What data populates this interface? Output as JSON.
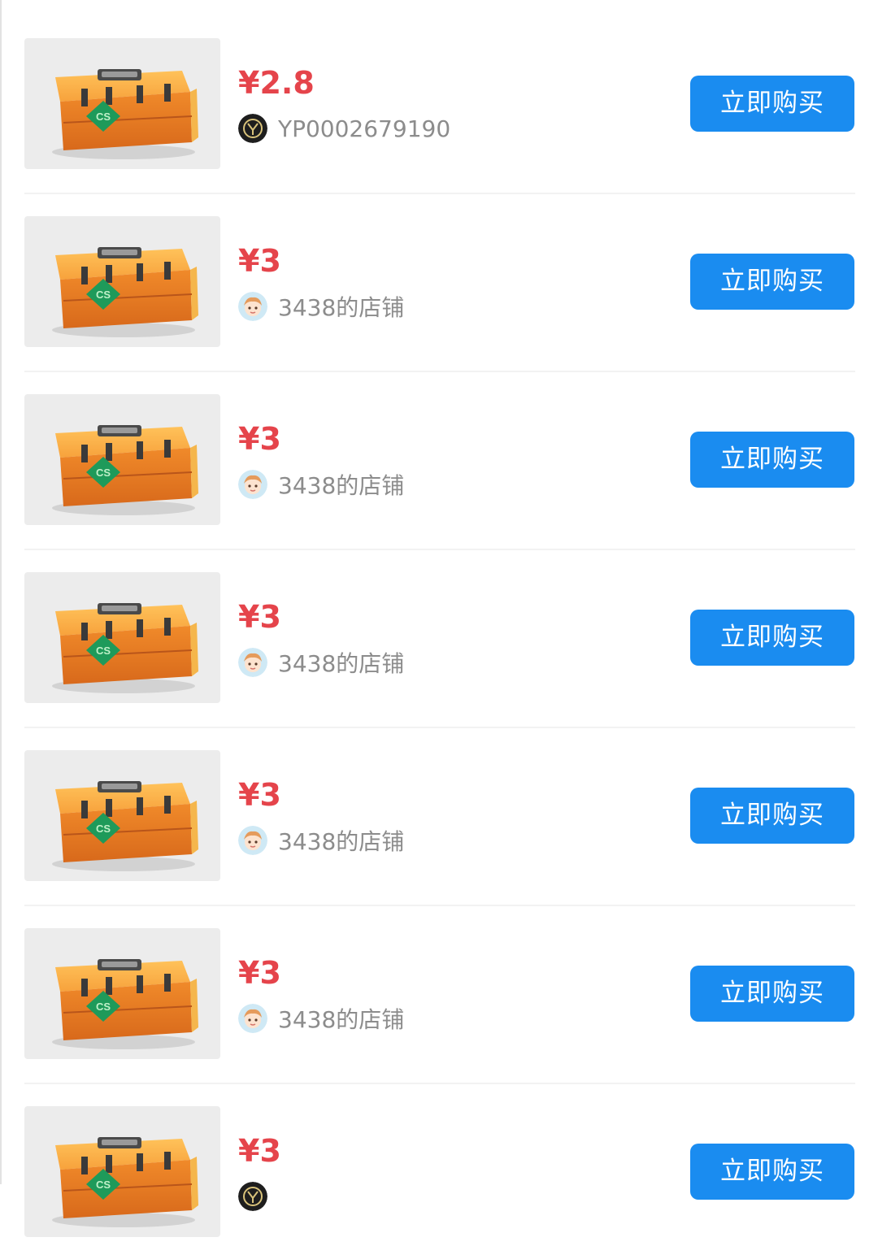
{
  "listings": [
    {
      "price": "¥2.8",
      "seller": "YP0002679190",
      "seller_avatar": "logo-avatar",
      "buy_label": "立即购买"
    },
    {
      "price": "¥3",
      "seller": "3438的店铺",
      "seller_avatar": "cartoon-avatar",
      "buy_label": "立即购买"
    },
    {
      "price": "¥3",
      "seller": "3438的店铺",
      "seller_avatar": "cartoon-avatar",
      "buy_label": "立即购买"
    },
    {
      "price": "¥3",
      "seller": "3438的店铺",
      "seller_avatar": "cartoon-avatar",
      "buy_label": "立即购买"
    },
    {
      "price": "¥3",
      "seller": "3438的店铺",
      "seller_avatar": "cartoon-avatar",
      "buy_label": "立即购买"
    },
    {
      "price": "¥3",
      "seller": "3438的店铺",
      "seller_avatar": "cartoon-avatar",
      "buy_label": "立即购买"
    },
    {
      "price": "¥3",
      "seller": "",
      "seller_avatar": "logo-avatar",
      "buy_label": "立即购买"
    }
  ],
  "product_image": {
    "icon": "cs-weapon-case-icon",
    "case_label": "CS"
  },
  "colors": {
    "price": "#e5444b",
    "button": "#1a8cf0",
    "button_text": "#ffffff",
    "seller_text": "#8c8c8c",
    "thumb_bg": "#ececec",
    "case_orange": "#f08a2a",
    "case_emblem": "#1e9a5a"
  }
}
